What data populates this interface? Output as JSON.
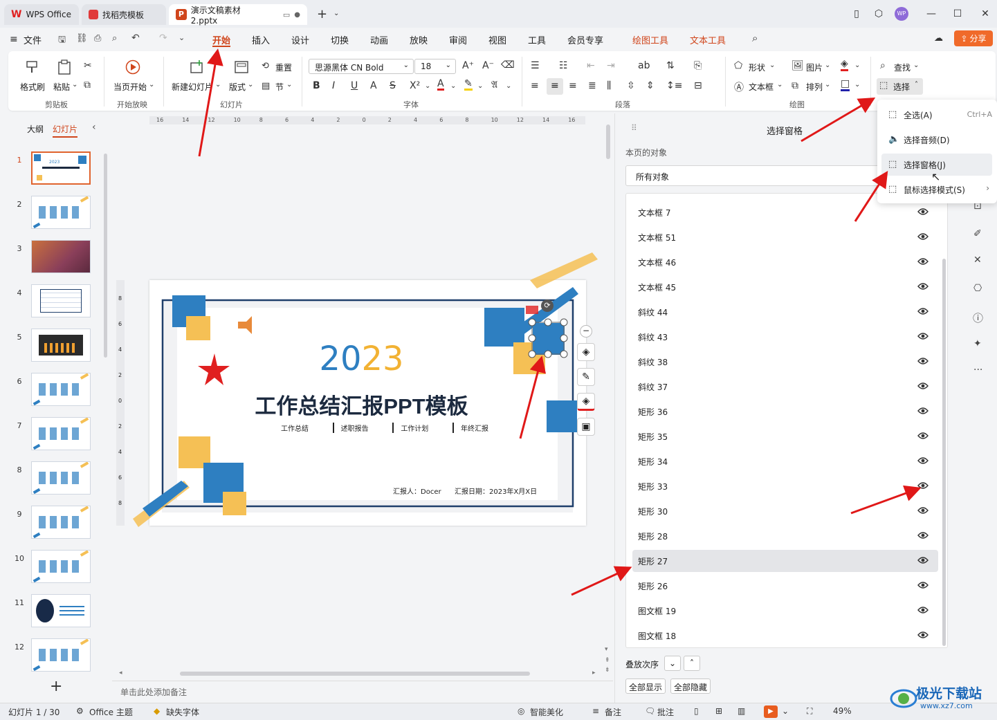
{
  "titlebar": {
    "tabs": [
      {
        "label": "WPS Office"
      },
      {
        "label": "找稻壳模板"
      },
      {
        "label": "演示文稿素材2.pptx"
      }
    ],
    "user_badge": "WP"
  },
  "menubar": {
    "file": "文件",
    "items": [
      "开始",
      "插入",
      "设计",
      "切换",
      "动画",
      "放映",
      "审阅",
      "视图",
      "工具",
      "会员专享"
    ],
    "context_items": [
      "绘图工具",
      "文本工具"
    ],
    "share": "分享"
  },
  "ribbon": {
    "format_painter": "格式刷",
    "paste": "粘贴",
    "clipboard_group": "剪贴板",
    "play_from_current": "当页开始",
    "play_group": "开始放映",
    "new_slide": "新建幻灯片",
    "layout": "版式",
    "reset": "重置",
    "section": "节",
    "slide_group": "幻灯片",
    "font_name": "思源黑体 CN Bold",
    "font_size": "18",
    "font_group": "字体",
    "paragraph_group": "段落",
    "shape": "形状",
    "picture": "图片",
    "textbox": "文本框",
    "arrange": "排列",
    "drawing_group": "绘图",
    "find": "查找",
    "select": "选择",
    "colors": {
      "font_red": "#e02020",
      "highlight": "#f5d000",
      "accent": "#d0451b"
    }
  },
  "dropdown": {
    "items": [
      {
        "label": "全选(A)",
        "shortcut": "Ctrl+A"
      },
      {
        "label": "选择音频(D)",
        "shortcut": ""
      },
      {
        "label": "选择窗格(J)",
        "shortcut": ""
      },
      {
        "label": "鼠标选择模式(S)",
        "shortcut": ""
      }
    ]
  },
  "leftpanel": {
    "outline_tab": "大纲",
    "slides_tab": "幻灯片",
    "slide_numbers": [
      "1",
      "2",
      "3",
      "4",
      "5",
      "6",
      "7",
      "8",
      "9",
      "10",
      "11",
      "12"
    ],
    "add": "+"
  },
  "ruler": {
    "h_ticks": [
      "16",
      "14",
      "12",
      "10",
      "8",
      "6",
      "4",
      "2",
      "0",
      "2",
      "4",
      "6",
      "8",
      "10",
      "12",
      "14",
      "16"
    ],
    "v_ticks": [
      "8",
      "6",
      "4",
      "2",
      "0",
      "2",
      "4",
      "6",
      "8"
    ]
  },
  "slide": {
    "year": "2023",
    "year_colors": [
      "#2e7fc1",
      "#2e7fc1",
      "#f2b233",
      "#f2b233"
    ],
    "title": "工作总结汇报PPT模板",
    "tags": [
      "工作总结",
      "述职报告",
      "工作计划",
      "年终汇报"
    ],
    "reporter": "汇报人：Docer",
    "date": "汇报日期：2023年X月X日",
    "colors": {
      "blue": "#2e7fc1",
      "yellow": "#f5c055",
      "red": "#e02020",
      "navy": "#1f3f6b"
    }
  },
  "notes_placeholder": "单击此处添加备注",
  "selpane": {
    "title": "选择窗格",
    "subtitle": "本页的对象",
    "filter": "所有对象",
    "objects": [
      {
        "label": "文本框 7",
        "selected": false
      },
      {
        "label": "文本框 51",
        "selected": false
      },
      {
        "label": "文本框 46",
        "selected": false
      },
      {
        "label": "文本框 45",
        "selected": false
      },
      {
        "label": "斜纹 44",
        "selected": false
      },
      {
        "label": "斜纹 43",
        "selected": false
      },
      {
        "label": "斜纹 38",
        "selected": false
      },
      {
        "label": "斜纹 37",
        "selected": false
      },
      {
        "label": "矩形 36",
        "selected": false
      },
      {
        "label": "矩形 35",
        "selected": false
      },
      {
        "label": "矩形 34",
        "selected": false
      },
      {
        "label": "矩形 33",
        "selected": false
      },
      {
        "label": "矩形 30",
        "selected": false
      },
      {
        "label": "矩形 28",
        "selected": false
      },
      {
        "label": "矩形 27",
        "selected": true
      },
      {
        "label": "矩形 26",
        "selected": false
      },
      {
        "label": "图文框 19",
        "selected": false
      },
      {
        "label": "图文框 18",
        "selected": false
      }
    ],
    "order_label": "叠放次序",
    "show_all": "全部显示",
    "hide_all": "全部隐藏"
  },
  "statusbar": {
    "slide_info": "幻灯片 1 / 30",
    "theme": "Office 主题",
    "missing_font": "缺失字体",
    "smart_beautify": "智能美化",
    "notes": "备注",
    "comments": "批注",
    "zoom": "49%"
  },
  "watermark": {
    "text": "极光下载站",
    "url": "www.xz7.com"
  }
}
